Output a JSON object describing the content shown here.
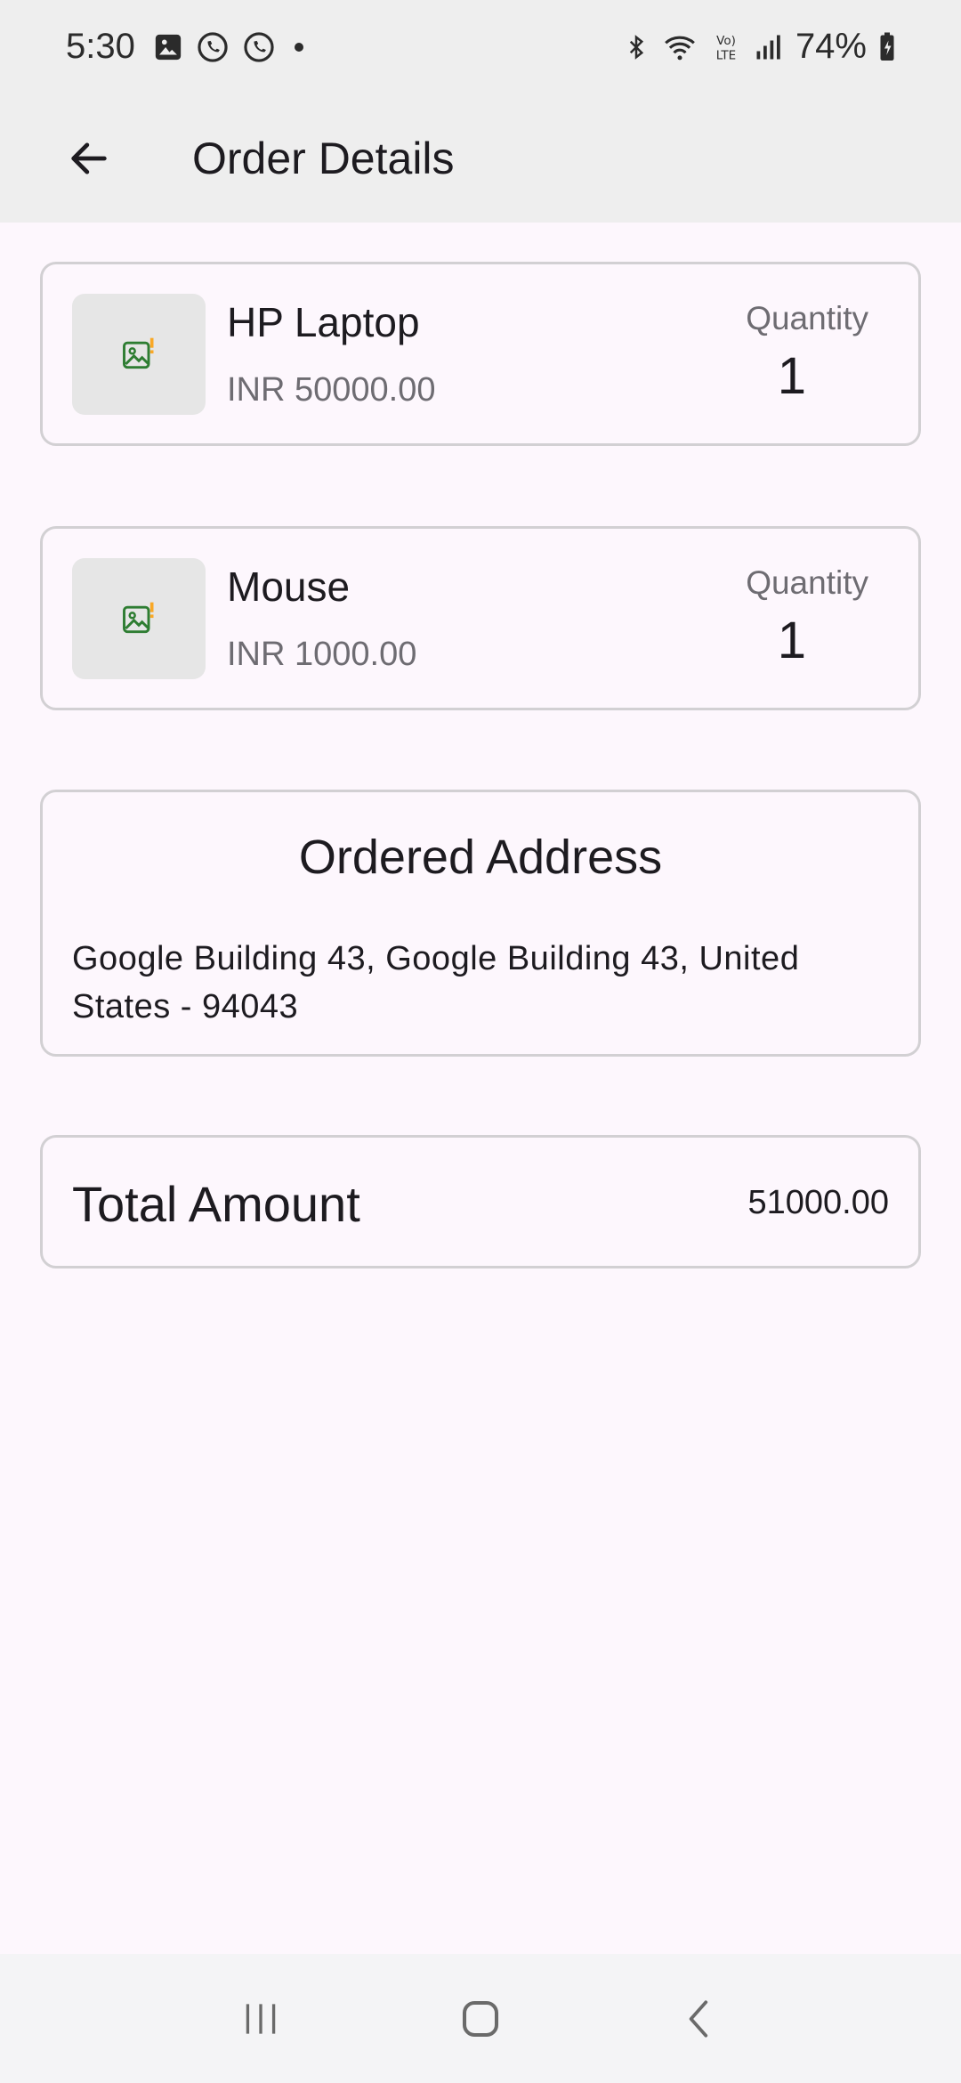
{
  "status_bar": {
    "time": "5:30",
    "battery": "74%",
    "notification_icons": [
      "gallery-icon",
      "whatsapp-icon",
      "whatsapp-icon",
      "dot-icon"
    ],
    "system_icons": [
      "bluetooth-icon",
      "wifi-icon",
      "volte-icon",
      "signal-icon",
      "battery-icon"
    ]
  },
  "app_bar": {
    "title": "Order Details"
  },
  "items": [
    {
      "name": "HP Laptop",
      "price": "INR 50000.00",
      "quantity_label": "Quantity",
      "quantity": "1"
    },
    {
      "name": "Mouse",
      "price": "INR 1000.00",
      "quantity_label": "Quantity",
      "quantity": "1"
    }
  ],
  "address": {
    "title": "Ordered Address",
    "text": "Google Building 43, Google Building 43, United States - 94043"
  },
  "total": {
    "label": "Total Amount",
    "value": "51000.00"
  },
  "colors": {
    "background": "#fdf7fd",
    "bar": "#eeeeee",
    "card_border": "#d2d0d3",
    "thumb_bg": "#e6e6e6",
    "image_icon": "#2e7d32",
    "image_icon_alert": "#f9a825"
  }
}
